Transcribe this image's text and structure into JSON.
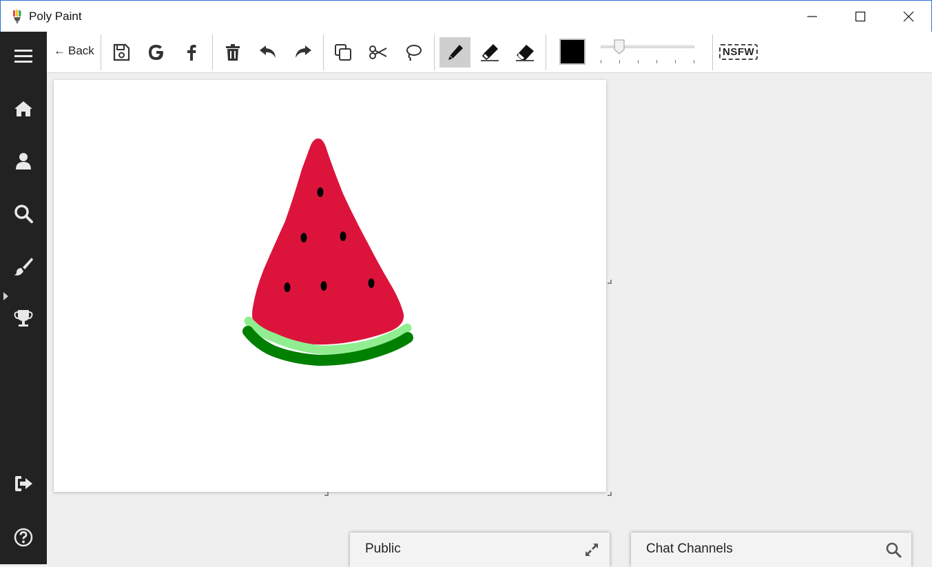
{
  "window": {
    "title": "Poly Paint",
    "controls": [
      "minimize",
      "maximize",
      "close"
    ]
  },
  "sidebar": {
    "items": [
      {
        "name": "menu-icon",
        "interactable": true
      },
      {
        "name": "home-icon",
        "interactable": true
      },
      {
        "name": "user-icon",
        "interactable": true
      },
      {
        "name": "search-icon",
        "interactable": true
      },
      {
        "name": "brush-icon",
        "interactable": true,
        "active": true
      },
      {
        "name": "trophy-icon",
        "interactable": true
      },
      {
        "name": "logout-icon",
        "interactable": true
      },
      {
        "name": "help-icon",
        "interactable": true
      }
    ]
  },
  "toolbar": {
    "back_label": "Back",
    "back_arrow": "←",
    "tools": [
      "save-icon",
      "google-icon",
      "facebook-icon",
      "trash-icon",
      "undo-icon",
      "redo-icon",
      "duplicate-icon",
      "cut-icon",
      "lasso-icon",
      "pencil-icon",
      "marker-icon",
      "eraser-icon"
    ],
    "active_tool": "pencil-icon",
    "stroke_color": "#000000",
    "stroke_size_level": 0.2,
    "nsfw_label": "NSFW"
  },
  "canvas": {
    "background": "#ffffff",
    "drawing": "watermelon-slice",
    "colors": {
      "flesh": "#dc143c",
      "seed": "#000000",
      "rind_light": "#90ee90",
      "rind_dark": "#008000"
    }
  },
  "chat": {
    "public_label": "Public",
    "channels_label": "Chat Channels"
  }
}
